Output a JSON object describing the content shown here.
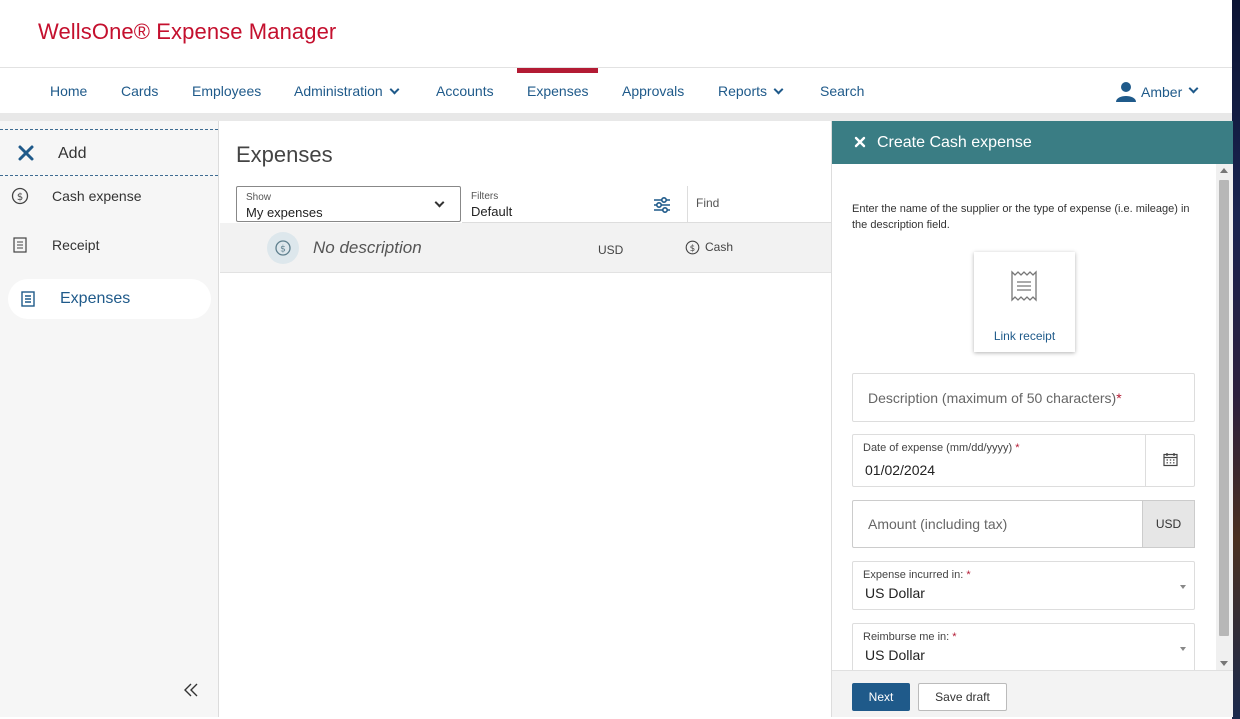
{
  "brand": {
    "title": "WellsOne® Expense Manager",
    "color": "#c4102e"
  },
  "nav": {
    "items": [
      {
        "label": "Home"
      },
      {
        "label": "Cards"
      },
      {
        "label": "Employees"
      },
      {
        "label": "Administration"
      },
      {
        "label": "Accounts"
      },
      {
        "label": "Expenses"
      },
      {
        "label": "Approvals"
      },
      {
        "label": "Reports"
      },
      {
        "label": "Search"
      }
    ],
    "active": "Expenses",
    "user": "Amber"
  },
  "sidebar": {
    "add_label": "Add",
    "items": [
      {
        "label": "Cash expense",
        "icon": "dollar-circle-icon"
      },
      {
        "label": "Receipt",
        "icon": "receipt-icon"
      }
    ],
    "selected": {
      "label": "Expenses",
      "icon": "list-icon"
    }
  },
  "main": {
    "title": "Expenses",
    "show": {
      "label": "Show",
      "value": "My expenses"
    },
    "filters": {
      "label": "Filters",
      "value": "Default"
    },
    "find_label": "Find",
    "rows": [
      {
        "description": "No description",
        "currency": "USD",
        "payment": "Cash"
      }
    ]
  },
  "panel": {
    "title": "Create Cash expense",
    "help_text": "Enter the name of the supplier or the type of expense (i.e. mileage) in the description field.",
    "link_receipt": "Link receipt",
    "description_placeholder": "Description (maximum of 50 characters)",
    "date": {
      "label": "Date of expense (mm/dd/yyyy)",
      "value": "01/02/2024"
    },
    "amount": {
      "placeholder": "Amount (including tax)",
      "currency": "USD"
    },
    "incurred": {
      "label": "Expense incurred in:",
      "value": "US Dollar"
    },
    "reimburse": {
      "label": "Reimburse me in:",
      "value": "US Dollar"
    },
    "required_mark": "*",
    "next_button": "Next",
    "save_draft_button": "Save draft",
    "header_color": "#3a7d84"
  }
}
